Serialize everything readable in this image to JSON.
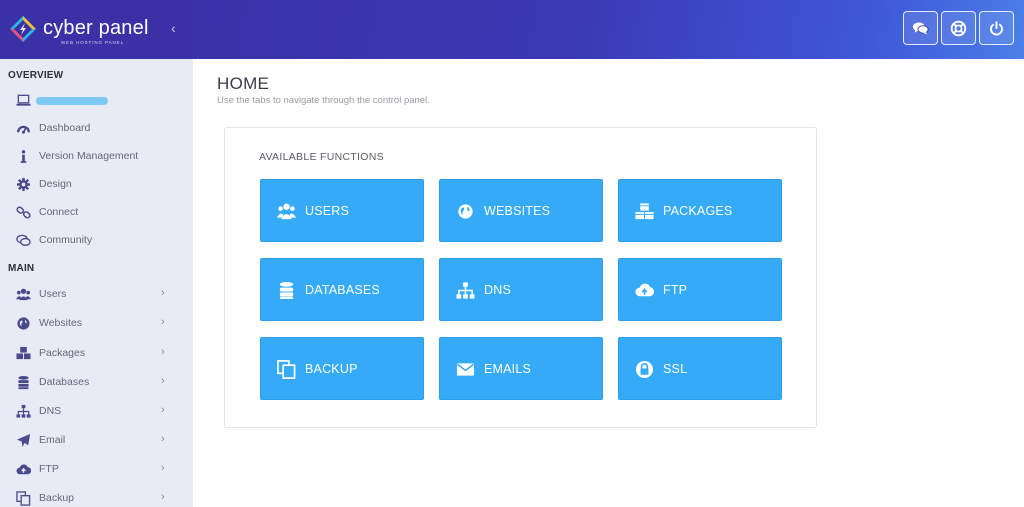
{
  "brand": {
    "name": "cyber panel",
    "tagline": "WEB HOSTING PANEL",
    "collapse_glyph": "‹"
  },
  "header": {
    "buttons": [
      {
        "name": "chat-icon"
      },
      {
        "name": "support-icon"
      },
      {
        "name": "power-icon"
      }
    ]
  },
  "sidebar": {
    "overview_title": "OVERVIEW",
    "overview_items": [
      {
        "label": "Dashboard",
        "icon": "dashboard-icon"
      },
      {
        "label": "Version Management",
        "icon": "info-icon"
      },
      {
        "label": "Design",
        "icon": "gear-icon"
      },
      {
        "label": "Connect",
        "icon": "link-icon"
      },
      {
        "label": "Community",
        "icon": "comments-icon"
      }
    ],
    "main_title": "MAIN",
    "main_items": [
      {
        "label": "Users",
        "icon": "users-icon"
      },
      {
        "label": "Websites",
        "icon": "globe-icon"
      },
      {
        "label": "Packages",
        "icon": "cubes-icon"
      },
      {
        "label": "Databases",
        "icon": "database-icon"
      },
      {
        "label": "DNS",
        "icon": "sitemap-icon"
      },
      {
        "label": "Email",
        "icon": "paper-plane-icon"
      },
      {
        "label": "FTP",
        "icon": "cloud-upload-icon"
      },
      {
        "label": "Backup",
        "icon": "copy-icon"
      }
    ],
    "chevron": "›"
  },
  "main": {
    "title": "HOME",
    "subtitle": "Use the tabs to navigate through the control panel.",
    "panel_title": "AVAILABLE FUNCTIONS",
    "functions": [
      {
        "label": "USERS",
        "icon": "users-icon"
      },
      {
        "label": "WEBSITES",
        "icon": "globe-icon"
      },
      {
        "label": "PACKAGES",
        "icon": "cubes-icon"
      },
      {
        "label": "DATABASES",
        "icon": "database-icon"
      },
      {
        "label": "DNS",
        "icon": "sitemap-icon"
      },
      {
        "label": "FTP",
        "icon": "cloud-upload-icon"
      },
      {
        "label": "BACKUP",
        "icon": "copy-icon"
      },
      {
        "label": "EMAILS",
        "icon": "envelope-icon"
      },
      {
        "label": "SSL",
        "icon": "lock-icon"
      }
    ]
  },
  "colors": {
    "header_start": "#3a2fa0",
    "header_end": "#4a7fe8",
    "sidebar_bg": "#e8ebf6",
    "function_button": "#35aaf7",
    "user_pill": "#7ec9f1"
  }
}
